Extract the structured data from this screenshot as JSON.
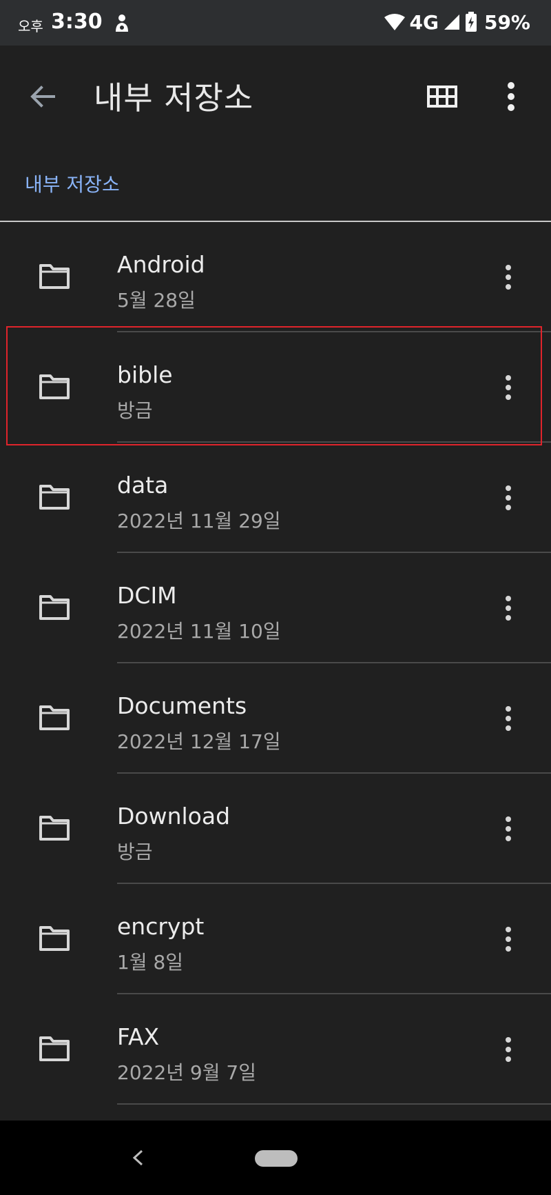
{
  "status_bar": {
    "time_prefix": "오후",
    "time": "3:30",
    "network": "4G",
    "battery": "59%"
  },
  "app_bar": {
    "title": "내부 저장소",
    "back_icon": "arrow-back-icon",
    "grid_icon": "grid-view-icon",
    "menu_icon": "more-vert-icon"
  },
  "breadcrumb": "내부 저장소",
  "files": [
    {
      "name": "Android",
      "date": "5월 28일"
    },
    {
      "name": "bible",
      "date": "방금"
    },
    {
      "name": "data",
      "date": "2022년 11월 29일"
    },
    {
      "name": "DCIM",
      "date": "2022년 11월 10일"
    },
    {
      "name": "Documents",
      "date": "2022년 12월 17일"
    },
    {
      "name": "Download",
      "date": "방금"
    },
    {
      "name": "encrypt",
      "date": "1월 8일"
    },
    {
      "name": "FAX",
      "date": "2022년 9월 7일"
    }
  ],
  "colors": {
    "background": "#202020",
    "status_bar": "#2d2f31",
    "accent": "#8ab4f8",
    "highlight": "#e0242b"
  }
}
